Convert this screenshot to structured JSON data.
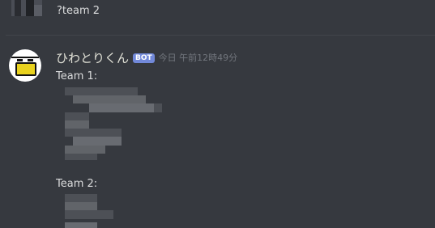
{
  "previous_message": {
    "text": "?team 2"
  },
  "message": {
    "username": "ひわとりくん",
    "bot_tag": "BOT",
    "timestamp": "今日 午前12時49分",
    "team1_label": "Team 1:",
    "team2_label": "Team 2:"
  }
}
